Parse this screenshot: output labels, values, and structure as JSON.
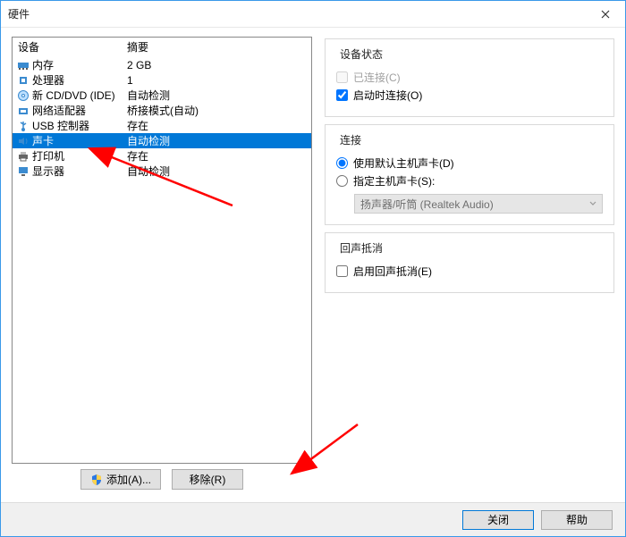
{
  "window": {
    "title": "硬件"
  },
  "list": {
    "headers": {
      "device": "设备",
      "summary": "摘要"
    },
    "items": [
      {
        "icon": "memory",
        "name": "内存",
        "summary": "2 GB",
        "selected": false
      },
      {
        "icon": "cpu",
        "name": "处理器",
        "summary": "1",
        "selected": false
      },
      {
        "icon": "disc",
        "name": "新 CD/DVD (IDE)",
        "summary": "自动检测",
        "selected": false
      },
      {
        "icon": "nic",
        "name": "网络适配器",
        "summary": "桥接模式(自动)",
        "selected": false
      },
      {
        "icon": "usb",
        "name": "USB 控制器",
        "summary": "存在",
        "selected": false
      },
      {
        "icon": "sound",
        "name": "声卡",
        "summary": "自动检测",
        "selected": true
      },
      {
        "icon": "printer",
        "name": "打印机",
        "summary": "存在",
        "selected": false
      },
      {
        "icon": "display",
        "name": "显示器",
        "summary": "自动检测",
        "selected": false
      }
    ],
    "buttons": {
      "add": "添加(A)...",
      "remove": "移除(R)"
    }
  },
  "panels": {
    "status": {
      "title": "设备状态",
      "connected": "已连接(C)",
      "connect_at_power": "启动时连接(O)"
    },
    "connection": {
      "title": "连接",
      "default_host": "使用默认主机声卡(D)",
      "specify_host": "指定主机声卡(S):",
      "combo_value": "扬声器/听筒 (Realtek Audio)"
    },
    "echo": {
      "title": "回声抵消",
      "enable": "启用回声抵消(E)"
    }
  },
  "footer": {
    "close": "关闭",
    "help": "帮助"
  },
  "icons": {
    "memory": "m",
    "cpu": "c",
    "disc": "d",
    "nic": "n",
    "usb": "u",
    "sound": "s",
    "printer": "p",
    "display": "v"
  }
}
